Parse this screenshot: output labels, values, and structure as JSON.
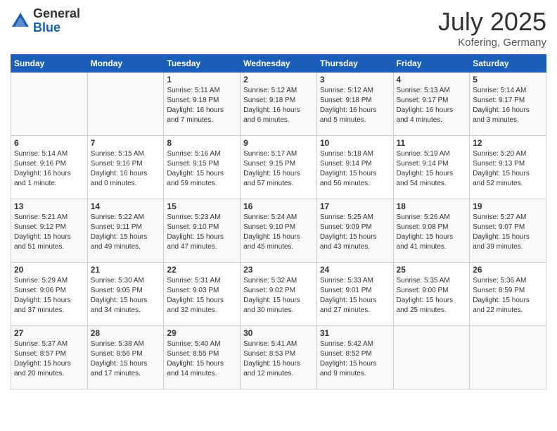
{
  "header": {
    "logo_general": "General",
    "logo_blue": "Blue",
    "month_year": "July 2025",
    "location": "Kofering, Germany"
  },
  "days_of_week": [
    "Sunday",
    "Monday",
    "Tuesday",
    "Wednesday",
    "Thursday",
    "Friday",
    "Saturday"
  ],
  "weeks": [
    [
      {
        "day": "",
        "content": ""
      },
      {
        "day": "",
        "content": ""
      },
      {
        "day": "1",
        "content": "Sunrise: 5:11 AM\nSunset: 9:18 PM\nDaylight: 16 hours\nand 7 minutes."
      },
      {
        "day": "2",
        "content": "Sunrise: 5:12 AM\nSunset: 9:18 PM\nDaylight: 16 hours\nand 6 minutes."
      },
      {
        "day": "3",
        "content": "Sunrise: 5:12 AM\nSunset: 9:18 PM\nDaylight: 16 hours\nand 5 minutes."
      },
      {
        "day": "4",
        "content": "Sunrise: 5:13 AM\nSunset: 9:17 PM\nDaylight: 16 hours\nand 4 minutes."
      },
      {
        "day": "5",
        "content": "Sunrise: 5:14 AM\nSunset: 9:17 PM\nDaylight: 16 hours\nand 3 minutes."
      }
    ],
    [
      {
        "day": "6",
        "content": "Sunrise: 5:14 AM\nSunset: 9:16 PM\nDaylight: 16 hours\nand 1 minute."
      },
      {
        "day": "7",
        "content": "Sunrise: 5:15 AM\nSunset: 9:16 PM\nDaylight: 16 hours\nand 0 minutes."
      },
      {
        "day": "8",
        "content": "Sunrise: 5:16 AM\nSunset: 9:15 PM\nDaylight: 15 hours\nand 59 minutes."
      },
      {
        "day": "9",
        "content": "Sunrise: 5:17 AM\nSunset: 9:15 PM\nDaylight: 15 hours\nand 57 minutes."
      },
      {
        "day": "10",
        "content": "Sunrise: 5:18 AM\nSunset: 9:14 PM\nDaylight: 15 hours\nand 56 minutes."
      },
      {
        "day": "11",
        "content": "Sunrise: 5:19 AM\nSunset: 9:14 PM\nDaylight: 15 hours\nand 54 minutes."
      },
      {
        "day": "12",
        "content": "Sunrise: 5:20 AM\nSunset: 9:13 PM\nDaylight: 15 hours\nand 52 minutes."
      }
    ],
    [
      {
        "day": "13",
        "content": "Sunrise: 5:21 AM\nSunset: 9:12 PM\nDaylight: 15 hours\nand 51 minutes."
      },
      {
        "day": "14",
        "content": "Sunrise: 5:22 AM\nSunset: 9:11 PM\nDaylight: 15 hours\nand 49 minutes."
      },
      {
        "day": "15",
        "content": "Sunrise: 5:23 AM\nSunset: 9:10 PM\nDaylight: 15 hours\nand 47 minutes."
      },
      {
        "day": "16",
        "content": "Sunrise: 5:24 AM\nSunset: 9:10 PM\nDaylight: 15 hours\nand 45 minutes."
      },
      {
        "day": "17",
        "content": "Sunrise: 5:25 AM\nSunset: 9:09 PM\nDaylight: 15 hours\nand 43 minutes."
      },
      {
        "day": "18",
        "content": "Sunrise: 5:26 AM\nSunset: 9:08 PM\nDaylight: 15 hours\nand 41 minutes."
      },
      {
        "day": "19",
        "content": "Sunrise: 5:27 AM\nSunset: 9:07 PM\nDaylight: 15 hours\nand 39 minutes."
      }
    ],
    [
      {
        "day": "20",
        "content": "Sunrise: 5:29 AM\nSunset: 9:06 PM\nDaylight: 15 hours\nand 37 minutes."
      },
      {
        "day": "21",
        "content": "Sunrise: 5:30 AM\nSunset: 9:05 PM\nDaylight: 15 hours\nand 34 minutes."
      },
      {
        "day": "22",
        "content": "Sunrise: 5:31 AM\nSunset: 9:03 PM\nDaylight: 15 hours\nand 32 minutes."
      },
      {
        "day": "23",
        "content": "Sunrise: 5:32 AM\nSunset: 9:02 PM\nDaylight: 15 hours\nand 30 minutes."
      },
      {
        "day": "24",
        "content": "Sunrise: 5:33 AM\nSunset: 9:01 PM\nDaylight: 15 hours\nand 27 minutes."
      },
      {
        "day": "25",
        "content": "Sunrise: 5:35 AM\nSunset: 9:00 PM\nDaylight: 15 hours\nand 25 minutes."
      },
      {
        "day": "26",
        "content": "Sunrise: 5:36 AM\nSunset: 8:59 PM\nDaylight: 15 hours\nand 22 minutes."
      }
    ],
    [
      {
        "day": "27",
        "content": "Sunrise: 5:37 AM\nSunset: 8:57 PM\nDaylight: 15 hours\nand 20 minutes."
      },
      {
        "day": "28",
        "content": "Sunrise: 5:38 AM\nSunset: 8:56 PM\nDaylight: 15 hours\nand 17 minutes."
      },
      {
        "day": "29",
        "content": "Sunrise: 5:40 AM\nSunset: 8:55 PM\nDaylight: 15 hours\nand 14 minutes."
      },
      {
        "day": "30",
        "content": "Sunrise: 5:41 AM\nSunset: 8:53 PM\nDaylight: 15 hours\nand 12 minutes."
      },
      {
        "day": "31",
        "content": "Sunrise: 5:42 AM\nSunset: 8:52 PM\nDaylight: 15 hours\nand 9 minutes."
      },
      {
        "day": "",
        "content": ""
      },
      {
        "day": "",
        "content": ""
      }
    ]
  ]
}
